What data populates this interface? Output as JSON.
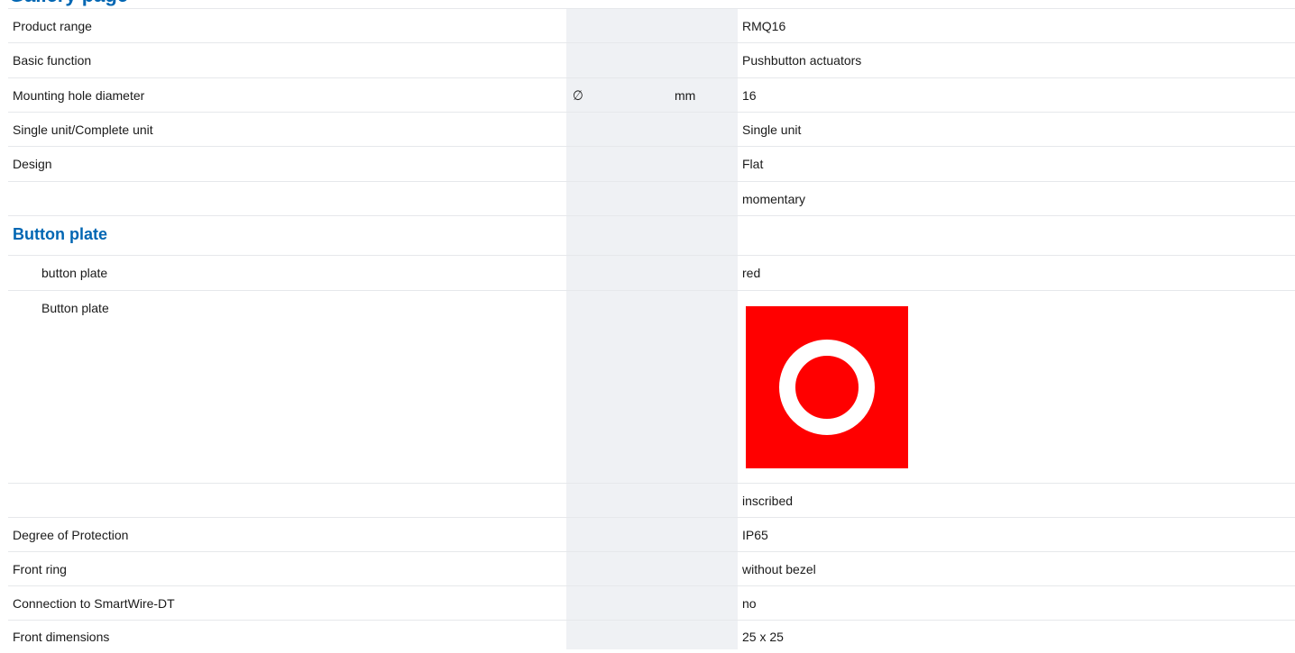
{
  "heading": "Gallery page",
  "rows": [
    {
      "label": "Product range",
      "value": "RMQ16"
    },
    {
      "label": "Basic function",
      "value": "Pushbutton actuators"
    },
    {
      "label": "Mounting hole diameter",
      "symbol": "∅",
      "unit": "mm",
      "value": "16"
    },
    {
      "label": "Single unit/Complete unit",
      "value": "Single unit"
    },
    {
      "label": "Design",
      "value": "Flat"
    },
    {
      "label": "",
      "value": "momentary"
    },
    {
      "label": "Button plate"
    },
    {
      "label": "button plate",
      "value": "red"
    },
    {
      "label": "Button plate",
      "pictogram": "red-square-ring-icon"
    },
    {
      "label": "",
      "value": "inscribed"
    },
    {
      "label": "Degree of Protection",
      "value": "IP65"
    },
    {
      "label": "Front ring",
      "value": "without bezel"
    },
    {
      "label": "Connection to SmartWire-DT",
      "value": "no"
    },
    {
      "label": "Front dimensions",
      "value": "25 x 25"
    }
  ],
  "colors": {
    "accent": "#0066b3",
    "pictogram": "#ff0000",
    "column_shade": "#eff1f4"
  }
}
